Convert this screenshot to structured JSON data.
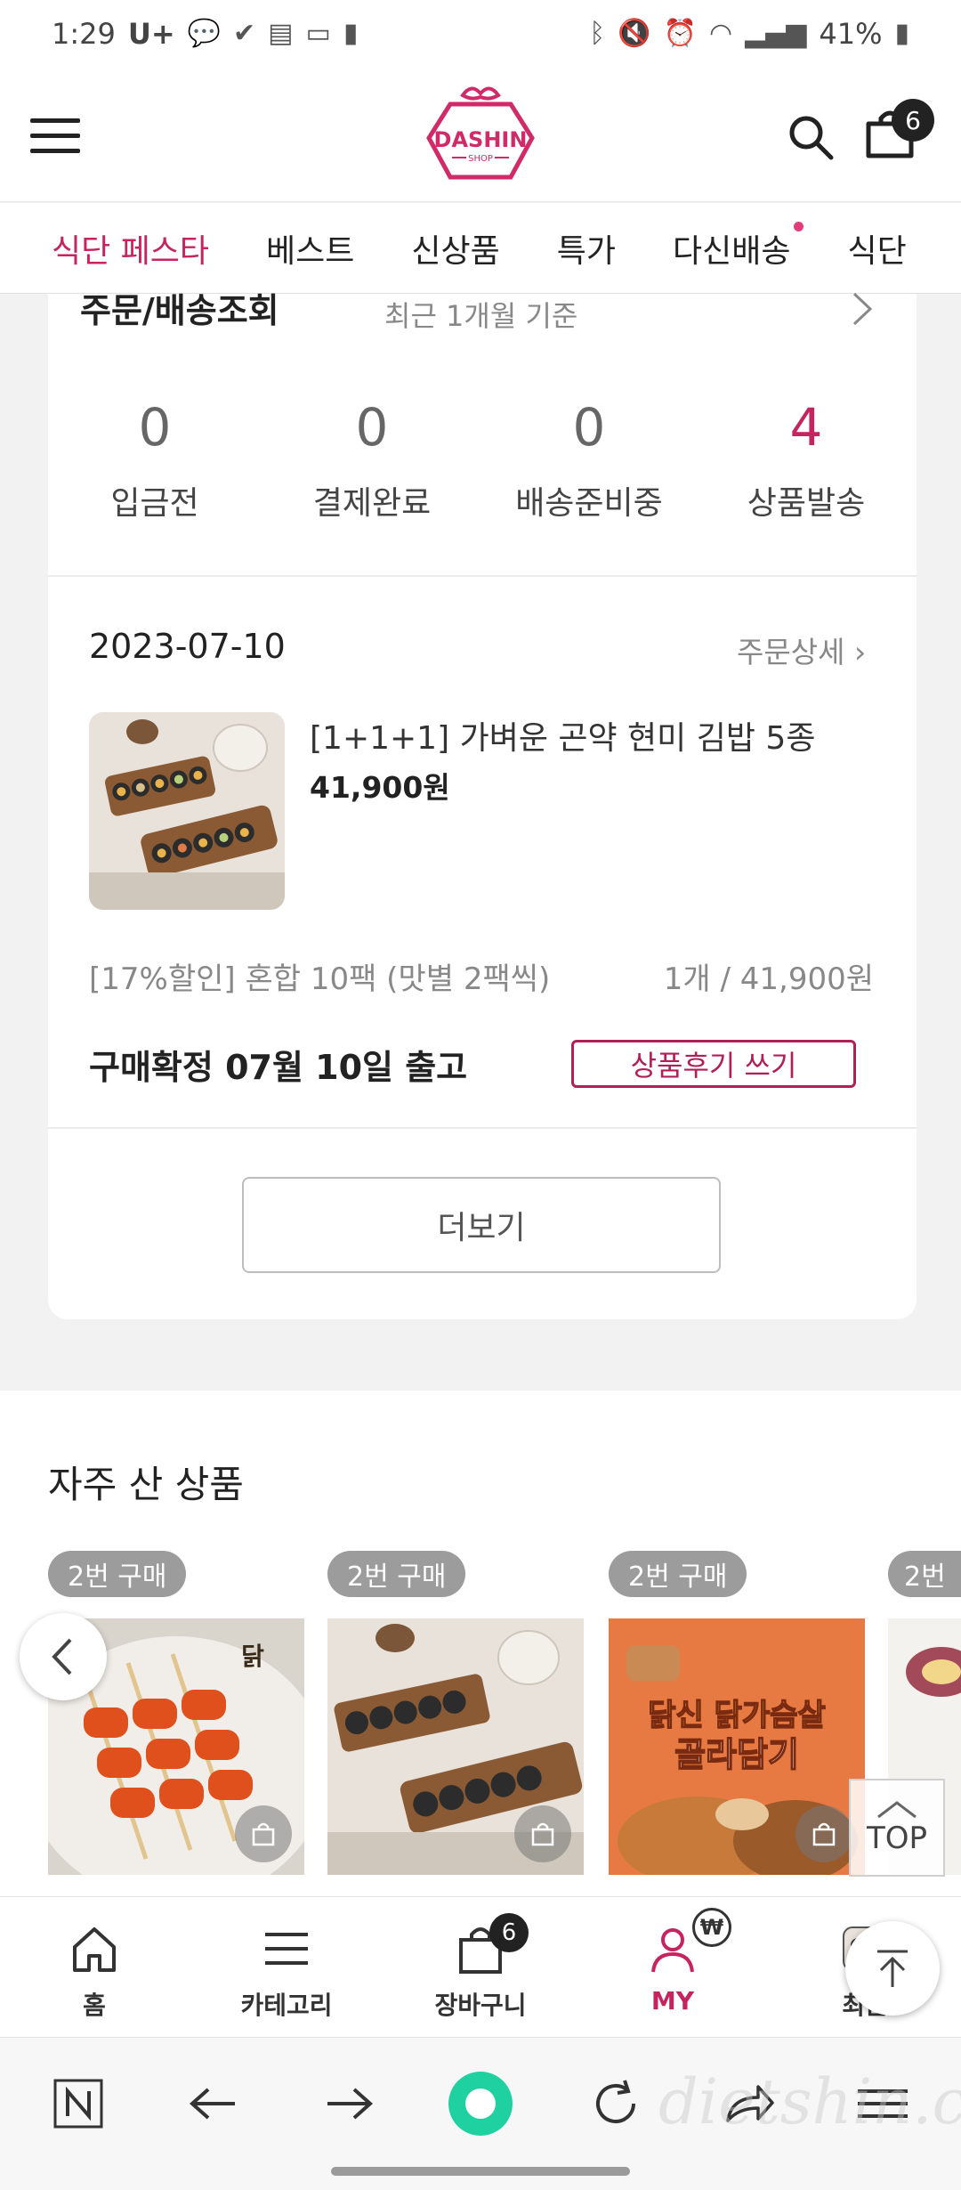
{
  "status_bar": {
    "time": "1:29",
    "carrier": "U+",
    "battery": "41%"
  },
  "header": {
    "logo_text": "DASHIN",
    "logo_sub": "SHOP",
    "cart_count": "6",
    "brand_color": "#c6245f"
  },
  "category_tabs": [
    "식단 페스타",
    "베스트",
    "신상품",
    "특가",
    "다신배송",
    "식단"
  ],
  "orders": {
    "title": "주문/배송조회",
    "subtitle": "최근 1개월 기준",
    "stats": [
      {
        "value": "0",
        "label": "입금전"
      },
      {
        "value": "0",
        "label": "결제완료"
      },
      {
        "value": "0",
        "label": "배송준비중"
      },
      {
        "value": "4",
        "label": "상품발송"
      }
    ],
    "order_date": "2023-07-10",
    "detail_link": "주문상세",
    "product_name": "[1+1+1] 가벼운 곤약 현미 김밥 5종",
    "product_price": "41,900원",
    "option": "[17%할인] 혼합 10팩 (맛별 2팩씩)",
    "quantity_price": "1개 / 41,900원",
    "confirm_text": "구매확정  07월 10일 출고",
    "review_button": "상품후기 쓰기",
    "more_button": "더보기"
  },
  "frequent": {
    "title": "자주 산 상품",
    "items": [
      {
        "badge": "2번 구매",
        "image": "tteokbokki-skewers"
      },
      {
        "badge": "2번 구매",
        "image": "kimbap"
      },
      {
        "badge": "2번 구매",
        "image": "chicken-breast-promo",
        "promo_line1": "닭신 닭가슴살",
        "promo_line2": "골라담기"
      },
      {
        "badge": "2번",
        "image": "sweet-potato"
      }
    ],
    "top_label": "TOP"
  },
  "bottom_nav": [
    {
      "label": "홈",
      "icon": "home-icon"
    },
    {
      "label": "카테고리",
      "icon": "menu-icon"
    },
    {
      "label": "장바구니",
      "icon": "cart-icon",
      "badge": "6"
    },
    {
      "label": "MY",
      "icon": "person-icon",
      "badge": "₩"
    },
    {
      "label": "최근",
      "icon": "recent-icon"
    }
  ],
  "watermark": "dietshin.com"
}
